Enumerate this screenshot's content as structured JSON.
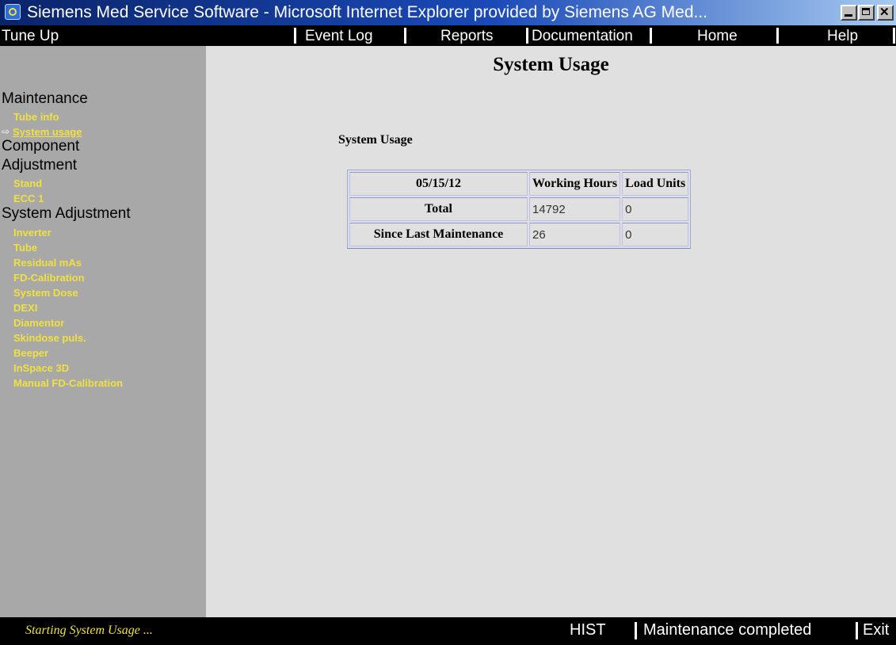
{
  "window": {
    "title": "Siemens Med Service Software - Microsoft Internet Explorer provided by Siemens AG Med..."
  },
  "menubar": {
    "left_title": "Tune Up",
    "items": [
      "Event Log",
      "Reports",
      "Documentation",
      "Home",
      "Help"
    ]
  },
  "sidebar": {
    "maintenance_heading": "Maintenance",
    "maintenance_items": [
      "Tube info",
      "System usage"
    ],
    "component_heading_line1": "Component",
    "component_heading_line2": "Adjustment",
    "component_items": [
      "Stand",
      "ECC 1"
    ],
    "system_heading": "System Adjustment",
    "system_items": [
      "Inverter",
      "Tube",
      "Residual mAs",
      "FD-Calibration",
      "System Dose",
      "DEXI",
      "Diamentor",
      "Skindose puls.",
      "Beeper",
      "InSpace 3D",
      "Manual FD-Calibration"
    ]
  },
  "main": {
    "title": "System Usage",
    "section_label": "System Usage",
    "table": {
      "headers": [
        "05/15/12",
        "Working Hours",
        "Load Units"
      ],
      "rows": [
        {
          "label": "Total",
          "working_hours": "14792",
          "load_units": "0"
        },
        {
          "label": "Since Last Maintenance",
          "working_hours": "26",
          "load_units": "0"
        }
      ]
    }
  },
  "statusbar": {
    "message": "Starting System Usage ...",
    "items": [
      "HIST",
      "Maintenance completed",
      "Exit"
    ]
  }
}
